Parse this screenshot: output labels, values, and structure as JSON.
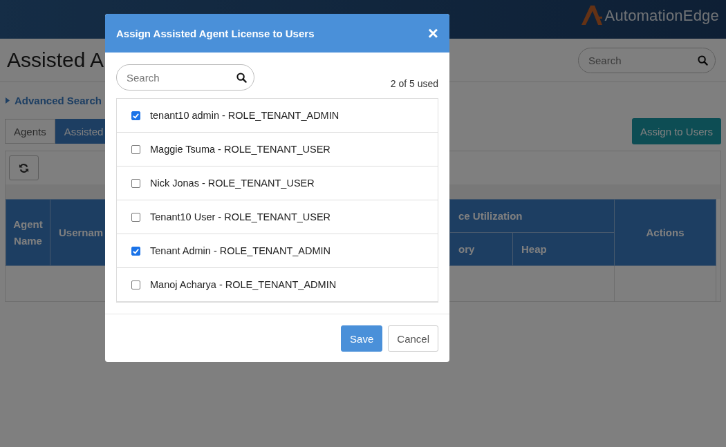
{
  "header": {
    "logo_text": "AutomationEdge"
  },
  "page": {
    "title": "Assisted A",
    "search": {
      "placeholder": "Search"
    },
    "advanced_search": "Advanced Search",
    "tabs": [
      {
        "label": "Agents",
        "selected": false
      },
      {
        "label": "Assisted",
        "selected": true
      }
    ],
    "assign_button": "Assign to Users",
    "table": {
      "columns": [
        "Agent Name",
        "Usernam"
      ],
      "group_header": "ce Utilization",
      "subcolumns": [
        "ory",
        "Heap"
      ],
      "actions": "Actions"
    }
  },
  "modal": {
    "title": "Assign Assisted Agent License to Users",
    "close": "×",
    "search": {
      "placeholder": "Search"
    },
    "usage": "2 of 5 used",
    "users": [
      {
        "label": "tenant10 admin - ROLE_TENANT_ADMIN",
        "checked": true
      },
      {
        "label": "Maggie Tsuma - ROLE_TENANT_USER",
        "checked": false
      },
      {
        "label": "Nick Jonas - ROLE_TENANT_USER",
        "checked": false
      },
      {
        "label": "Tenant10 User - ROLE_TENANT_USER",
        "checked": false
      },
      {
        "label": "Tenant Admin - ROLE_TENANT_ADMIN",
        "checked": true
      },
      {
        "label": "Manoj Acharya - ROLE_TENANT_ADMIN",
        "checked": false
      }
    ],
    "buttons": [
      {
        "label": "Save",
        "kind": "primary"
      },
      {
        "label": "Cancel",
        "kind": "secondary"
      }
    ]
  }
}
